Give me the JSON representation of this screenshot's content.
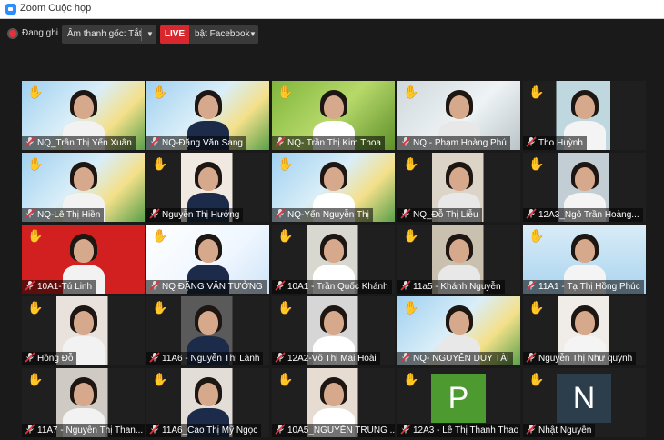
{
  "window": {
    "title": "Zoom Cuộc họp"
  },
  "toolbar": {
    "recording_label": "Đang ghi",
    "audio_label": "Âm thanh gốc: Tắt",
    "live_badge": "LIVE",
    "live_target": "bật Facebook"
  },
  "colors": {
    "background": "#1a1a1a",
    "live_red": "#d9272e",
    "mic_muted_red": "#e6303b",
    "hand_yellow": "#f5b400",
    "tile_P": "#4d9a30",
    "tile_N": "#2c3e4c"
  },
  "participants": [
    {
      "name": "NQ_Trần Thị Yến Xuân",
      "hand": true,
      "muted": true
    },
    {
      "name": "NQ-Đặng Văn Sang",
      "hand": true,
      "muted": true
    },
    {
      "name": "NQ- Trần Thị Kim Thoa",
      "hand": true,
      "muted": true
    },
    {
      "name": "NQ - Phạm Hoàng Phú",
      "hand": true,
      "muted": true
    },
    {
      "name": "Tho Huỳnh",
      "hand": true,
      "muted": true
    },
    {
      "name": "NQ-Lê Thị Hiền",
      "hand": true,
      "muted": true
    },
    {
      "name": "Nguyễn Thị Hướng",
      "hand": true,
      "muted": true
    },
    {
      "name": "NQ-Yến Nguyễn Thị",
      "hand": true,
      "muted": true
    },
    {
      "name": "NQ_Đỗ Thị Liễu",
      "hand": true,
      "muted": true
    },
    {
      "name": "12A3_Ngô Trần Hoàng...",
      "hand": true,
      "muted": true
    },
    {
      "name": "10A1-Tú Linh",
      "hand": true,
      "muted": true
    },
    {
      "name": "NQ ĐẶNG VĂN TƯỞNG",
      "hand": true,
      "muted": true
    },
    {
      "name": "10A1 - Trần Quốc Khánh",
      "hand": true,
      "muted": true
    },
    {
      "name": "11a5 - Khánh Nguyễn",
      "hand": true,
      "muted": true
    },
    {
      "name": "11A1 - Tạ Thị Hồng Phúc",
      "hand": true,
      "muted": true
    },
    {
      "name": "Hồng Đỗ",
      "hand": true,
      "muted": true
    },
    {
      "name": "11A6 - Nguyễn Thị Lành",
      "hand": true,
      "muted": true
    },
    {
      "name": "12A2-Võ Thị Mai Hoài",
      "hand": true,
      "muted": true
    },
    {
      "name": "NQ- NGUYỄN DUY TÀI",
      "hand": true,
      "muted": true
    },
    {
      "name": "Nguyễn Thị Như quỳnh",
      "hand": true,
      "muted": true
    },
    {
      "name": "11A7 - Nguyễn Thị Than...",
      "hand": true,
      "muted": true
    },
    {
      "name": "11A6_Cao Thị Mỹ Ngọc",
      "hand": true,
      "muted": true
    },
    {
      "name": "10A5_NGUYỄN TRUNG ...",
      "hand": true,
      "muted": true
    },
    {
      "name": "12A3 - Lê Thị Thanh Thao",
      "hand": true,
      "muted": true
    },
    {
      "name": "Nhật Nguyễn",
      "hand": true,
      "muted": true
    }
  ],
  "avatars": {
    "tile_24": "P",
    "tile_25": "N"
  }
}
